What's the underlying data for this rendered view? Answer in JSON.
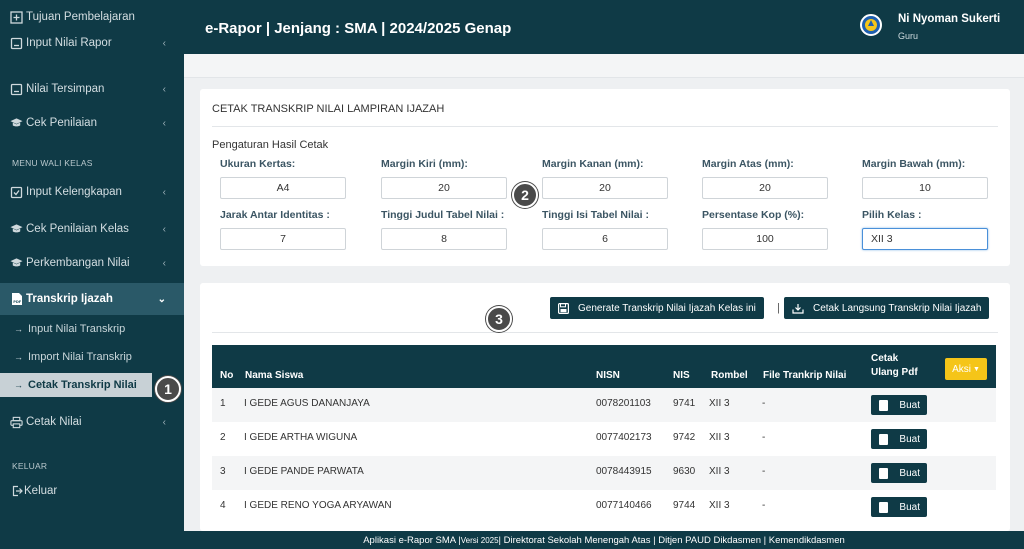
{
  "sidebar": {
    "tujuan": "Tujuan Pembelajaran",
    "input_nilai_rapor": "Input Nilai Rapor",
    "nilai_tersimpan": "Nilai Tersimpan",
    "cek_penilaian": "Cek Penilaian",
    "menu_wali_kelas": "MENU WALI KELAS",
    "input_kelengkapan": "Input Kelengkapan",
    "cek_penilaian_kelas": "Cek Penilaian Kelas",
    "perkembangan_nilai": "Perkembangan Nilai",
    "transkrip_ijazah": "Transkrip Ijazah",
    "input_nilai_transkrip": "Input Nilai Transkrip",
    "import_nilai_transkrip": "Import Nilai Transkrip",
    "cetak_transkrip_nilai": "Cetak Transkrip Nilai",
    "cetak_nilai": "Cetak Nilai",
    "keluar_header": "KELUAR",
    "keluar": "Keluar"
  },
  "header": {
    "title": "e-Rapor | Jenjang : SMA | 2024/2025 Genap",
    "user_name": "Ni Nyoman Sukerti",
    "user_role": "Guru"
  },
  "settings": {
    "card_title": "CETAK TRANSKRIP NILAI LAMPIRAN IJAZAH",
    "section_title": "Pengaturan Hasil Cetak",
    "fields": [
      {
        "label": "Ukuran Kertas:",
        "value": "A4"
      },
      {
        "label": "Margin Kiri (mm):",
        "value": "20"
      },
      {
        "label": "Margin Kanan (mm):",
        "value": "20"
      },
      {
        "label": "Margin Atas (mm):",
        "value": "20"
      },
      {
        "label": "Margin Bawah (mm):",
        "value": "10"
      },
      {
        "label": "Jarak Antar Identitas :",
        "value": "7"
      },
      {
        "label": "Tinggi Judul Tabel Nilai :",
        "value": "8"
      },
      {
        "label": "Tinggi Isi Tabel Nilai :",
        "value": "6"
      },
      {
        "label": "Persentase Kop (%):",
        "value": "100"
      },
      {
        "label": "Pilih Kelas :",
        "value": "XII 3"
      }
    ]
  },
  "actions": {
    "generate": "Generate Transkrip Nilai Ijazah Kelas ini",
    "separator": "|",
    "cetak_langsung": "Cetak Langsung Transkrip Nilai Ijazah"
  },
  "markers": {
    "one": "1",
    "two": "2",
    "three": "3"
  },
  "table": {
    "headers": {
      "no": "No",
      "nama": "Nama Siswa",
      "nisn": "NISN",
      "nis": "NIS",
      "rombel": "Rombel",
      "file": "File Trankrip Nilai",
      "cetak1": "Cetak",
      "cetak2": "Ulang Pdf",
      "aksi": "Aksi"
    },
    "rows": [
      {
        "no": "1",
        "nama": "I GEDE AGUS DANANJAYA",
        "nisn": "0078201103",
        "nis": "9741",
        "rombel": "XII 3",
        "file": "-",
        "btn": "Buat"
      },
      {
        "no": "2",
        "nama": "I GEDE ARTHA WIGUNA",
        "nisn": "0077402173",
        "nis": "9742",
        "rombel": "XII 3",
        "file": "-",
        "btn": "Buat"
      },
      {
        "no": "3",
        "nama": "I GEDE PANDE PARWATA",
        "nisn": "0078443915",
        "nis": "9630",
        "rombel": "XII 3",
        "file": "-",
        "btn": "Buat"
      },
      {
        "no": "4",
        "nama": "I GEDE RENO YOGA ARYAWAN",
        "nisn": "0077140466",
        "nis": "9744",
        "rombel": "XII 3",
        "file": "-",
        "btn": "Buat"
      }
    ]
  },
  "footer": {
    "text_a": "Aplikasi e-Rapor SMA | ",
    "text_small": "Versi 2025",
    "text_b": " | Direktorat Sekolah Menengah Atas | Ditjen PAUD Dikdasmen | Kemendikdasmen"
  },
  "colors": {
    "primary": "#0f3a46",
    "accent": "#f5c518",
    "active_item": "#2a5968",
    "background": "#eef0f2"
  }
}
